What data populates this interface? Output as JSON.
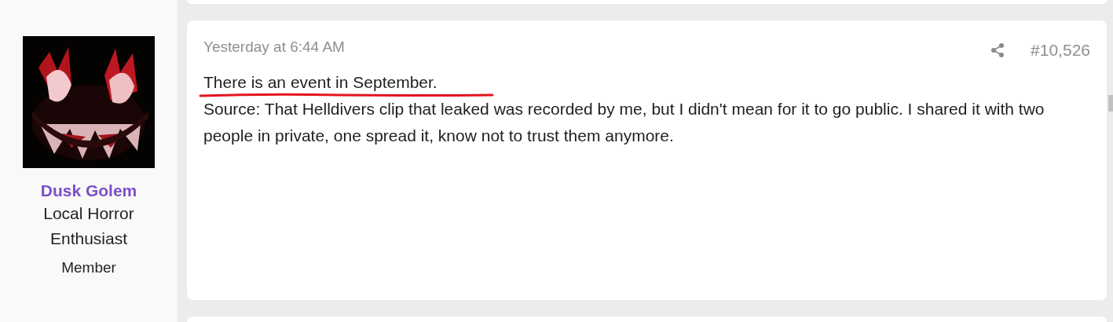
{
  "author": {
    "name": "Dusk Golem",
    "title_lines": [
      "Local Horror",
      "Enthusiast"
    ],
    "role": "Member"
  },
  "post": {
    "time": "Yesterday at 6:44 AM",
    "number": "#10,526",
    "lines": [
      {
        "text": "There is an event in September.",
        "underlined": true
      },
      {
        "text": "Source: That Helldivers clip that leaked was recorded by me, but I didn't mean for it to go public. I shared it with two people in private, one spread it, know not to trust them anymore.",
        "underlined": false
      }
    ]
  }
}
